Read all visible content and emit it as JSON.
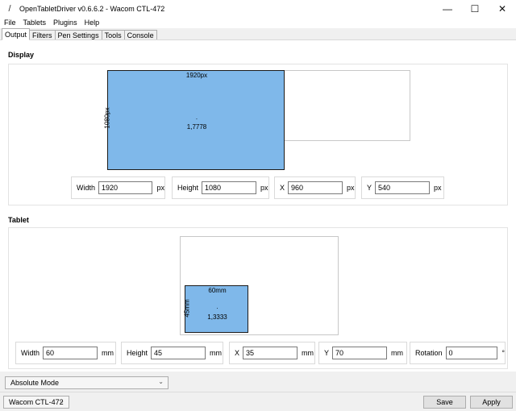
{
  "window": {
    "title": "OpenTabletDriver v0.6.6.2 - Wacom CTL-472",
    "minimize_glyph": "—",
    "maximize_glyph": "☐",
    "close_glyph": "✕",
    "app_icon_glyph": "/"
  },
  "menu": [
    "File",
    "Tablets",
    "Plugins",
    "Help"
  ],
  "tabs": [
    "Output",
    "Filters",
    "Pen Settings",
    "Tools",
    "Console"
  ],
  "display": {
    "section_title": "Display",
    "width_label": "1920px",
    "height_label": "1080px",
    "center_dot": "·",
    "ratio": "1,7778",
    "fields": {
      "width": {
        "label": "Width",
        "value": "1920",
        "unit": "px"
      },
      "height": {
        "label": "Height",
        "value": "1080",
        "unit": "px"
      },
      "x": {
        "label": "X",
        "value": "960",
        "unit": "px"
      },
      "y": {
        "label": "Y",
        "value": "540",
        "unit": "px"
      }
    }
  },
  "tablet": {
    "section_title": "Tablet",
    "width_label": "60mm",
    "height_label": "45mm",
    "center_dot": "·",
    "ratio": "1,3333",
    "fields": {
      "width": {
        "label": "Width",
        "value": "60",
        "unit": "mm"
      },
      "height": {
        "label": "Height",
        "value": "45",
        "unit": "mm"
      },
      "x": {
        "label": "X",
        "value": "35",
        "unit": "mm"
      },
      "y": {
        "label": "Y",
        "value": "70",
        "unit": "mm"
      },
      "rotation": {
        "label": "Rotation",
        "value": "0",
        "unit": "°"
      }
    }
  },
  "mode_dropdown": {
    "value": "Absolute Mode",
    "chevron": "⌄"
  },
  "bottom": {
    "tablet_dropdown": "Wacom CTL-472",
    "chevron": "⌄",
    "save_label": "Save",
    "apply_label": "Apply"
  },
  "colors": {
    "area_fill": "#7fb8ea",
    "area_border": "#1b1b1b"
  }
}
